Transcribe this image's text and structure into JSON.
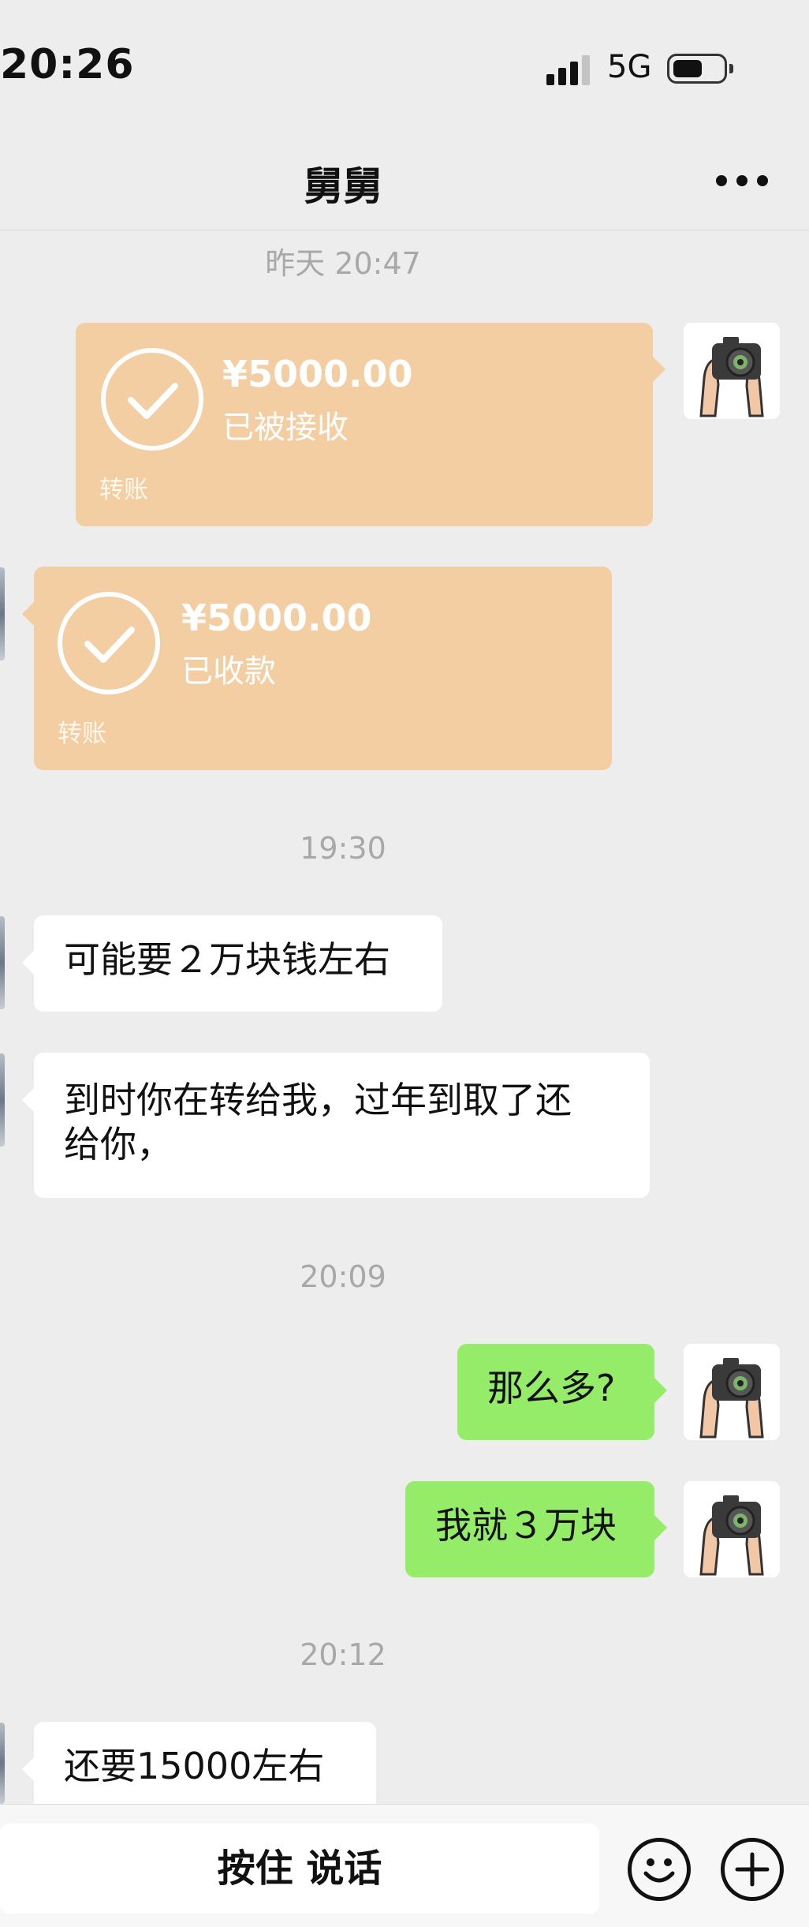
{
  "status_bar": {
    "time": "20:26",
    "network": "5G",
    "battery_level": 0.55,
    "signal_bars": 4
  },
  "nav": {
    "title": "舅舅",
    "more_icon": "more-dots-icon"
  },
  "messages": {
    "ts1": "昨天 20:47",
    "transfer_sent": {
      "amount": "¥5000.00",
      "status": "已被接收",
      "label": "转账"
    },
    "transfer_received": {
      "amount": "¥5000.00",
      "status": "已收款",
      "label": "转账"
    },
    "ts2": "19:30",
    "msg1": "可能要２万块钱左右",
    "msg2_line1": "到时你在转给我，过年到取了还",
    "msg2_line2": "给你，",
    "ts3": "20:09",
    "msg3": "那么多?",
    "msg4": "我就３万块",
    "ts4": "20:12",
    "msg5": "还要15000左右"
  },
  "bottom_bar": {
    "talk_label": "按住 说话",
    "emoji_icon": "emoji-icon",
    "add_icon": "plus-circle-icon"
  },
  "colors": {
    "transfer_bg": "#f3cea3",
    "green_bubble": "#95ec69",
    "page_bg": "#ededed"
  }
}
